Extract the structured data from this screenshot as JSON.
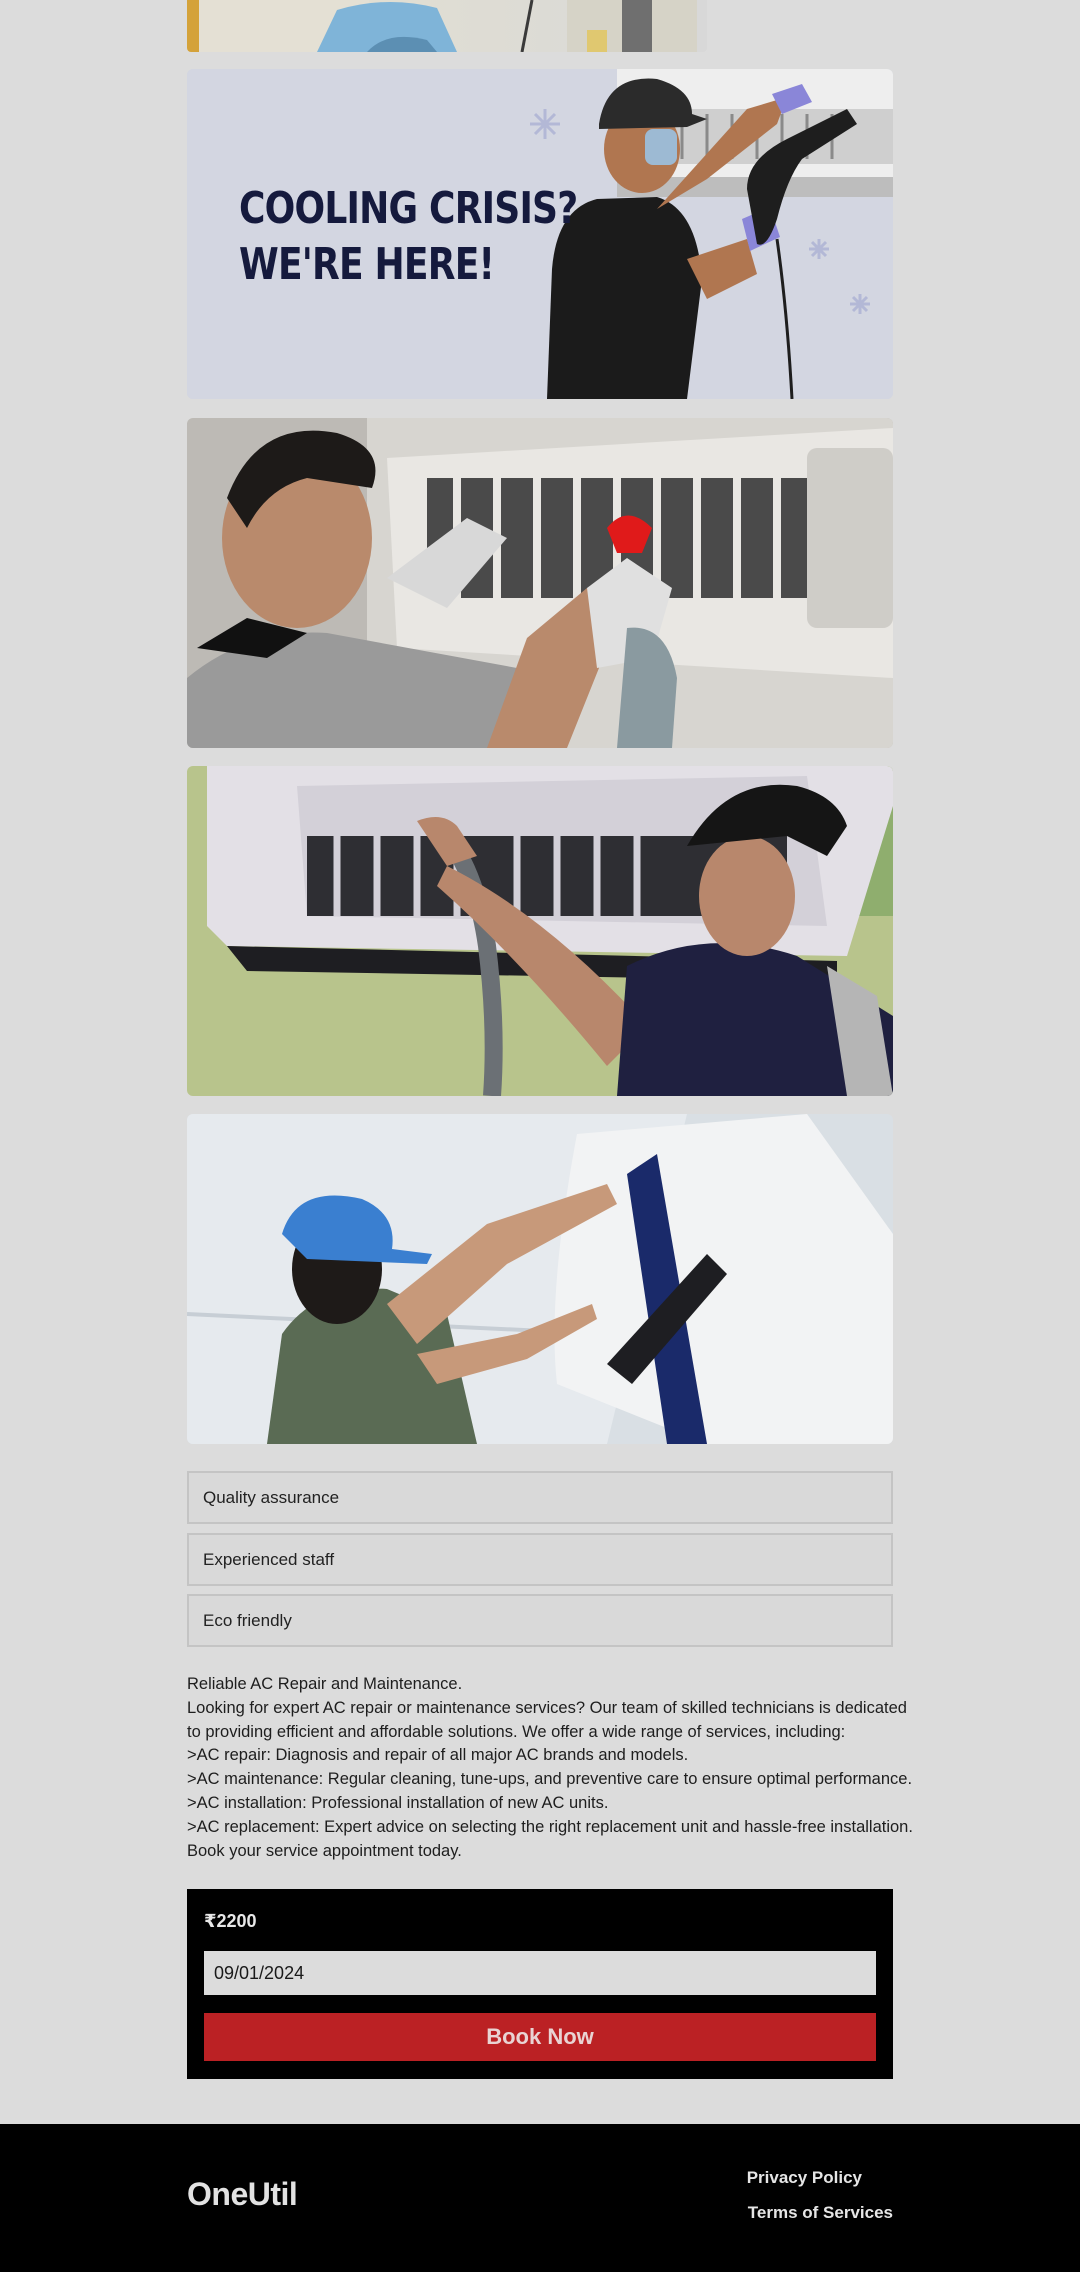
{
  "banner": {
    "line1": "COOLING CRISIS?",
    "line2": "WE'RE HERE!"
  },
  "features": [
    "Quality assurance",
    "Experienced staff",
    "Eco friendly"
  ],
  "description": [
    "Reliable AC Repair and Maintenance.",
    "Looking for expert AC repair or maintenance services? Our team of skilled technicians is dedicated",
    "to providing efficient and affordable solutions. We offer a wide range of services, including:",
    ">AC repair: Diagnosis and repair of all major AC brands and models.",
    ">AC maintenance: Regular cleaning, tune-ups, and preventive care to ensure optimal performance.",
    ">AC installation: Professional installation of new AC units.",
    ">AC replacement: Expert advice on selecting the right replacement unit and hassle-free installation.",
    "Book your service appointment today."
  ],
  "booking": {
    "price": "₹2200",
    "date_value": "09/01/2024",
    "book_label": "Book Now"
  },
  "footer": {
    "logo": "OneUtil",
    "privacy": "Privacy Policy",
    "terms": "Terms of Services"
  },
  "colors": {
    "page_bg": "#dcdcdc",
    "booking_bg": "#000000",
    "book_button": "#bb2124",
    "footer_bg": "#000000",
    "banner_bg": "#d3d6e1",
    "banner_text": "#151a3d"
  }
}
